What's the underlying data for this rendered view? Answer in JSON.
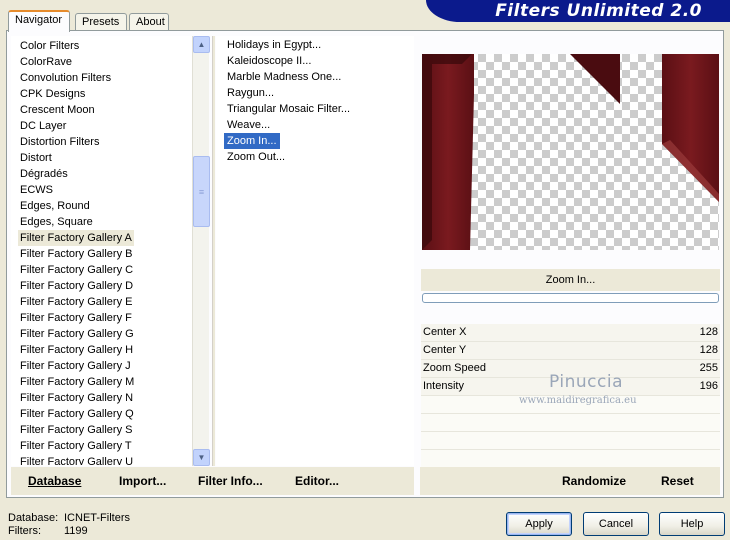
{
  "app": {
    "title": "Filters Unlimited 2.0"
  },
  "tabs": [
    {
      "label": "Navigator",
      "active": true
    },
    {
      "label": "Presets",
      "active": false
    },
    {
      "label": "About",
      "active": false
    }
  ],
  "categories": {
    "selected_index": 12,
    "items": [
      "Color Filters",
      "ColorRave",
      "Convolution Filters",
      "CPK Designs",
      "Crescent Moon",
      "DC Layer",
      "Distortion Filters",
      "Distort",
      "Dégradés",
      "ECWS",
      "Edges, Round",
      "Edges, Square",
      "Filter Factory Gallery A",
      "Filter Factory Gallery B",
      "Filter Factory Gallery C",
      "Filter Factory Gallery D",
      "Filter Factory Gallery E",
      "Filter Factory Gallery F",
      "Filter Factory Gallery G",
      "Filter Factory Gallery H",
      "Filter Factory Gallery J",
      "Filter Factory Gallery M",
      "Filter Factory Gallery N",
      "Filter Factory Gallery Q",
      "Filter Factory Gallery S",
      "Filter Factory Gallery T",
      "Filter Factory Gallery U"
    ]
  },
  "filters": {
    "selected_index": 6,
    "items": [
      "Holidays in Egypt...",
      "Kaleidoscope II...",
      "Marble Madness One...",
      "Raygun...",
      "Triangular Mosaic Filter...",
      "Weave...",
      "Zoom In...",
      "Zoom Out..."
    ]
  },
  "preview": {
    "selected_filter": "Zoom In...",
    "colors": {
      "dark_red": "#5a0f14",
      "mid_red": "#7a1a1f",
      "checker": "#cccccc"
    }
  },
  "params": [
    {
      "label": "Center X",
      "value": "128"
    },
    {
      "label": "Center Y",
      "value": "128"
    },
    {
      "label": "Zoom Speed",
      "value": "255"
    },
    {
      "label": "Intensity",
      "value": "196"
    }
  ],
  "watermark": {
    "name": "Pinuccia",
    "url": "www.maidiregrafica.eu"
  },
  "bottom_links": {
    "database": "Database",
    "import": "Import...",
    "filter_info": "Filter Info...",
    "editor": "Editor...",
    "randomize": "Randomize",
    "reset": "Reset"
  },
  "status": {
    "database_label": "Database:",
    "database_value": "ICNET-Filters",
    "filters_label": "Filters:",
    "filters_value": "1199"
  },
  "buttons": {
    "apply": "Apply",
    "cancel": "Cancel",
    "help": "Help"
  },
  "colors": {
    "banner": "#0b1a8c",
    "dialog_bg": "#ece9d8",
    "selection": "#316ac5"
  }
}
